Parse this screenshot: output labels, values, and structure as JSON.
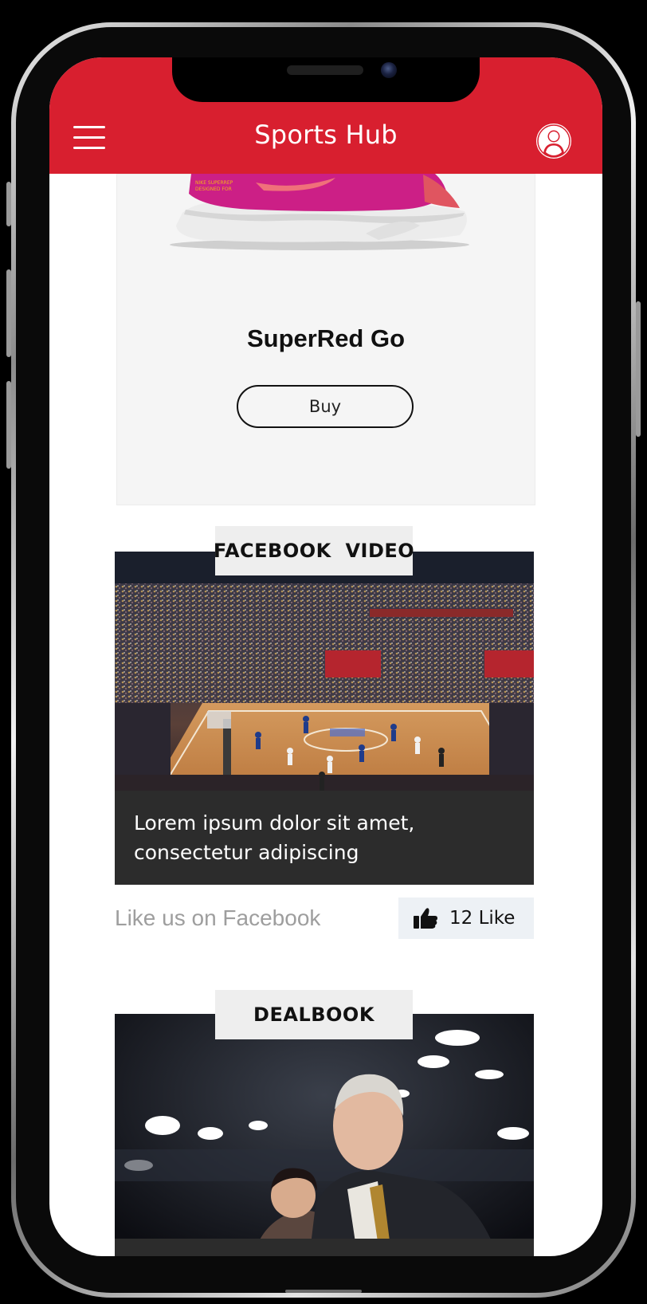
{
  "app": {
    "title": "Sports Hub",
    "accent_color": "#d81f2f"
  },
  "header": {
    "menu_icon": "hamburger-menu-icon",
    "profile_icon": "user-avatar-icon"
  },
  "product": {
    "name": "SuperRed Go",
    "buy_label": "Buy",
    "image": "pink-sneaker"
  },
  "facebook_video": {
    "tag": "FACEBOOK  VIDEO",
    "image": "basketball-arena",
    "caption_line1": "Lorem ipsum dolor sit amet,",
    "caption_line2": "consectetur adipiscing"
  },
  "social": {
    "like_prompt": "Like us on Facebook",
    "like_label": "12 Like",
    "like_icon": "thumbs-up-icon"
  },
  "dealbook": {
    "tag": "DEALBOOK",
    "image": "arena-crowd-photo"
  }
}
